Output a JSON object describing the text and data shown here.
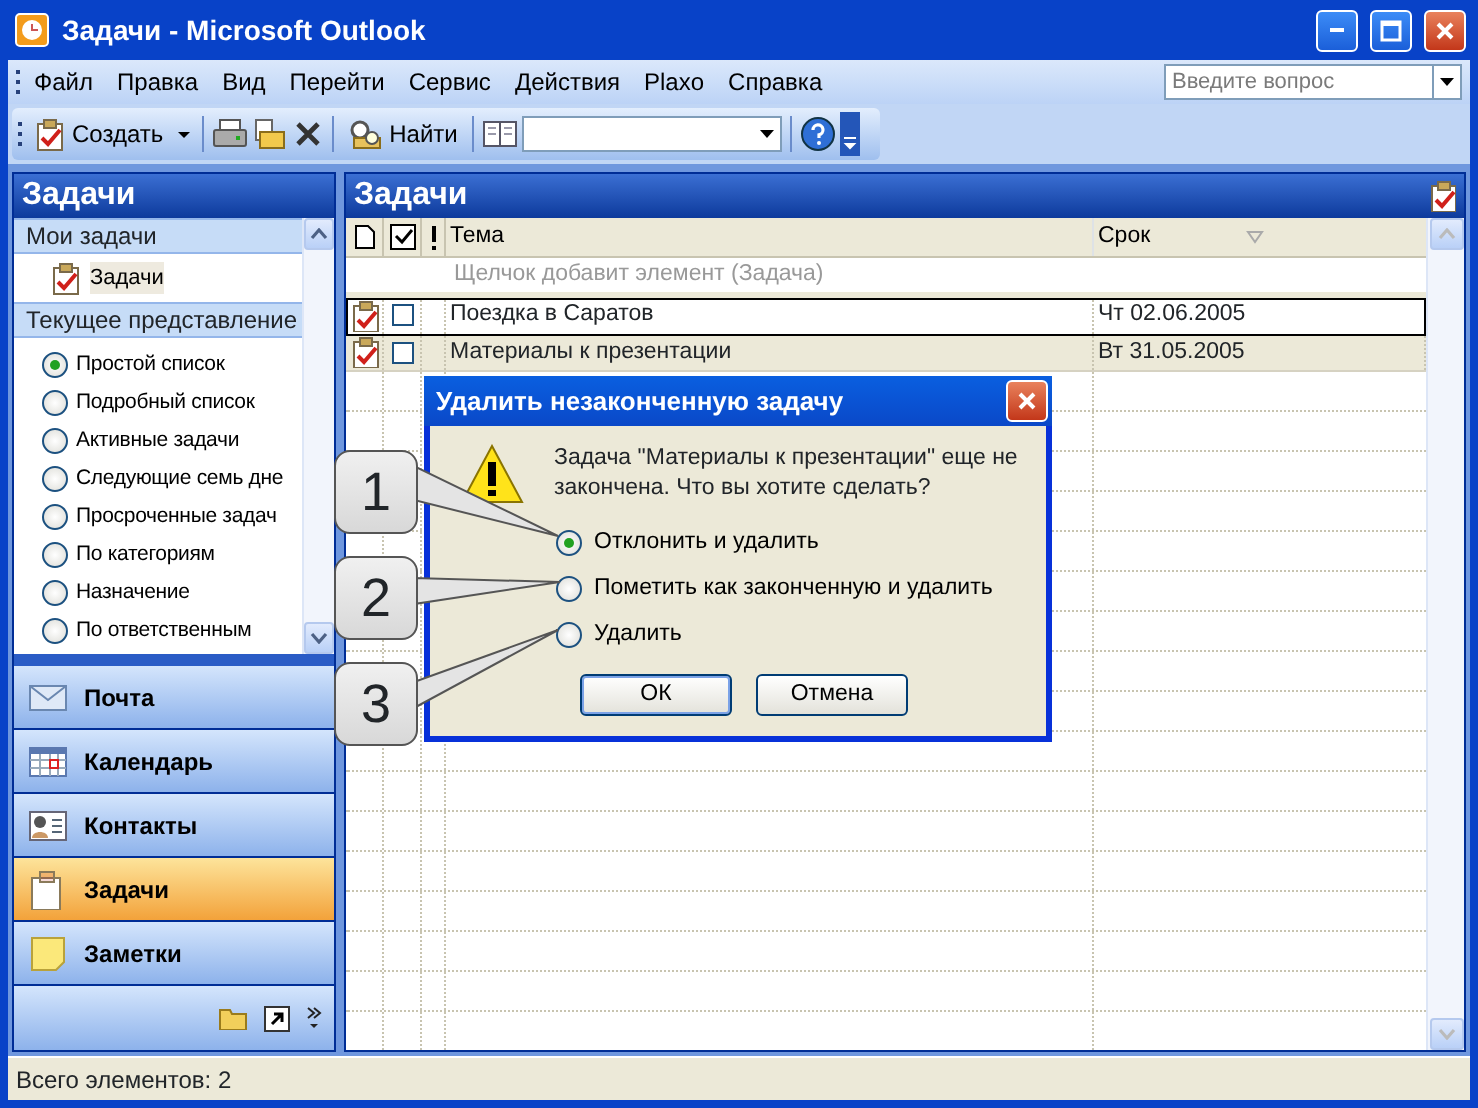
{
  "window": {
    "title": "Задачи - Microsoft Outlook"
  },
  "menu": [
    "Файл",
    "Правка",
    "Вид",
    "Перейти",
    "Сервис",
    "Действия",
    "Plaxo",
    "Справка"
  ],
  "help_search": {
    "placeholder": "Введите вопрос"
  },
  "toolbar": {
    "new_button": "Создать",
    "find_button": "Найти"
  },
  "left_pane": {
    "title": "Задачи",
    "my_tasks": {
      "header": "Мои задачи",
      "items": [
        {
          "label": "Задачи",
          "selected": true
        }
      ]
    },
    "current_view": {
      "header": "Текущее представление",
      "options": [
        {
          "label": "Простой список",
          "selected": true
        },
        {
          "label": "Подробный список",
          "selected": false
        },
        {
          "label": "Активные задачи",
          "selected": false
        },
        {
          "label": "Следующие семь дне",
          "selected": false
        },
        {
          "label": "Просроченные задач",
          "selected": false
        },
        {
          "label": "По категориям",
          "selected": false
        },
        {
          "label": "Назначение",
          "selected": false
        },
        {
          "label": "По ответственным",
          "selected": false
        }
      ]
    },
    "nav_buttons": [
      {
        "label": "Почта",
        "kind": "mail",
        "selected": false
      },
      {
        "label": "Календарь",
        "kind": "calendar",
        "selected": false
      },
      {
        "label": "Контакты",
        "kind": "contacts",
        "selected": false
      },
      {
        "label": "Задачи",
        "kind": "tasks",
        "selected": true
      },
      {
        "label": "Заметки",
        "kind": "notes",
        "selected": false
      }
    ]
  },
  "task_list": {
    "title": "Задачи",
    "columns": [
      "Тема",
      "Срок"
    ],
    "new_item_placeholder": "Щелчок добавит элемент (Задача)",
    "rows": [
      {
        "subject": "Поездка в Саратов",
        "due": "Чт 02.06.2005",
        "selected": false
      },
      {
        "subject": "Материалы к презентации",
        "due": "Вт 31.05.2005",
        "selected": true
      }
    ]
  },
  "dialog": {
    "title": "Удалить незаконченную задачу",
    "message": "Задача \"Материалы к презентации\" еще не закончена. Что вы хотите сделать?",
    "options": [
      {
        "label": "Отклонить и удалить",
        "selected": true
      },
      {
        "label": "Пометить как законченную и удалить",
        "selected": false
      },
      {
        "label": "Удалить",
        "selected": false
      }
    ],
    "buttons": [
      "ОК",
      "Отмена"
    ]
  },
  "callouts": [
    "1",
    "2",
    "3"
  ],
  "status_bar": "Всего элементов: 2"
}
